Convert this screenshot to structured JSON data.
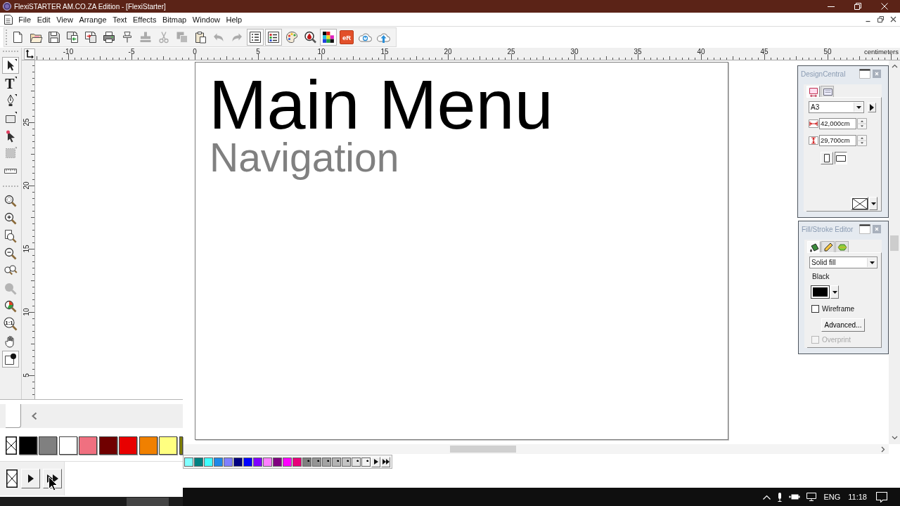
{
  "window": {
    "title": "FlexiSTARTER AM.CO.ZA Edition - [FlexiStarter]"
  },
  "menu": [
    "File",
    "Edit",
    "View",
    "Arrange",
    "Text",
    "Effects",
    "Bitmap",
    "Window",
    "Help"
  ],
  "toolbar": [
    {
      "pressed": false,
      "disabled": false
    },
    {
      "pressed": false,
      "disabled": false
    },
    {
      "pressed": false,
      "disabled": false
    },
    {
      "pressed": false,
      "disabled": false
    },
    {
      "pressed": false,
      "disabled": false
    },
    {
      "pressed": false,
      "disabled": false
    },
    {
      "pressed": false,
      "disabled": false
    },
    {
      "pressed": false,
      "disabled": true
    },
    {
      "pressed": false,
      "disabled": true
    },
    {
      "pressed": false,
      "disabled": true
    },
    {
      "pressed": false,
      "disabled": false
    },
    {
      "pressed": false,
      "disabled": true
    },
    {
      "pressed": false,
      "disabled": true
    },
    {
      "pressed": true,
      "disabled": false
    },
    {
      "pressed": true,
      "disabled": false
    },
    {
      "pressed": false,
      "disabled": false
    },
    {
      "pressed": false,
      "disabled": false
    },
    {
      "pressed": true,
      "disabled": false
    },
    {
      "label": "eR",
      "pressed": false,
      "disabled": false
    },
    {
      "pressed": false,
      "disabled": false
    },
    {
      "pressed": false,
      "disabled": false
    }
  ],
  "tool_groups": [
    {
      "tools": [
        {
          "selected": true,
          "disabled": false
        },
        {
          "label": "T",
          "selected": false,
          "disabled": false
        },
        {
          "selected": false,
          "disabled": false
        },
        {
          "selected": false,
          "disabled": false
        },
        {
          "selected": false,
          "disabled": false
        },
        {
          "selected": false,
          "disabled": true
        },
        {
          "selected": false,
          "disabled": false
        }
      ]
    },
    {
      "tools": [
        {
          "selected": false,
          "disabled": false
        },
        {
          "selected": false,
          "disabled": false
        },
        {
          "selected": false,
          "disabled": false
        },
        {
          "selected": false,
          "disabled": false
        },
        {
          "selected": false,
          "disabled": false
        },
        {
          "selected": false,
          "disabled": true
        },
        {
          "selected": false,
          "disabled": false
        },
        {
          "label": "1:1",
          "selected": false,
          "disabled": false
        },
        {
          "selected": false,
          "disabled": false
        },
        {
          "selected": true,
          "disabled": false
        }
      ]
    }
  ],
  "rulers": {
    "horizontal": [
      "-10",
      "-5",
      "0",
      "5",
      "10",
      "15",
      "20",
      "25",
      "30",
      "35",
      "40",
      "45",
      "50"
    ],
    "unit": "centimeters",
    "vertical": [
      "25",
      "20",
      "15",
      "10",
      "5"
    ]
  },
  "page": {
    "title": "Main Menu",
    "subtitle": "Navigation"
  },
  "design_central": {
    "title": "DesignCentral",
    "tabs": [
      {
        "selected": true
      },
      {
        "selected": false
      }
    ],
    "page_size": "A3",
    "width": "42,000cm",
    "height": "29,700cm",
    "orientation": [
      {
        "selected": false
      },
      {
        "selected": true
      }
    ]
  },
  "fill_stroke_editor": {
    "title": "Fill/Stroke Editor",
    "tabs": [
      {
        "selected": true
      },
      {
        "selected": false
      },
      {
        "selected": false
      }
    ],
    "fill_type": "Solid fill",
    "color_name": "Black",
    "color": "#000000",
    "wireframe": {
      "label": "Wireframe",
      "checked": false
    },
    "advanced_button": "Advanced...",
    "overprint": {
      "label": "Overprint",
      "checked": false,
      "disabled": true
    }
  },
  "palette": [
    {
      "kind": "solid",
      "color": "#80ffff"
    },
    {
      "kind": "solid",
      "color": "#008080"
    },
    {
      "kind": "solid",
      "color": "#40ffff"
    },
    {
      "kind": "solid",
      "color": "#1e88e8"
    },
    {
      "kind": "solid",
      "color": "#8080ff"
    },
    {
      "kind": "solid",
      "color": "#000080"
    },
    {
      "kind": "solid",
      "color": "#0000ff"
    },
    {
      "kind": "solid",
      "color": "#8000ff"
    },
    {
      "kind": "solid",
      "color": "#ff80ff"
    },
    {
      "kind": "solid",
      "color": "#800080"
    },
    {
      "kind": "solid",
      "color": "#ff00ff"
    },
    {
      "kind": "solid",
      "color": "#e8007a"
    },
    {
      "kind": "tint",
      "color": "#7f7f7f"
    },
    {
      "kind": "tint",
      "color": "#959595"
    },
    {
      "kind": "tint",
      "color": "#a3a3a3"
    },
    {
      "kind": "tint",
      "color": "#b3b3b3"
    },
    {
      "kind": "tint",
      "color": "#c3c3c3"
    },
    {
      "kind": "tint",
      "color": "#e3e3e3"
    },
    {
      "kind": "tint",
      "color": "#f3f3f3"
    }
  ],
  "floating_palette": {
    "swatches": [
      {
        "kind": "none"
      },
      {
        "kind": "solid",
        "color": "#000000"
      },
      {
        "kind": "solid",
        "color": "#808080"
      },
      {
        "kind": "solid",
        "color": "#ffffff"
      },
      {
        "kind": "solid",
        "color": "#f07080"
      },
      {
        "kind": "solid",
        "color": "#700000"
      },
      {
        "kind": "solid",
        "color": "#e80000"
      },
      {
        "kind": "solid",
        "color": "#f08000"
      },
      {
        "kind": "solid",
        "color": "#ffff80"
      },
      {
        "kind": "solid",
        "color": "#808000"
      }
    ]
  },
  "taskbar": {
    "language": "ENG",
    "time": "11:18"
  }
}
